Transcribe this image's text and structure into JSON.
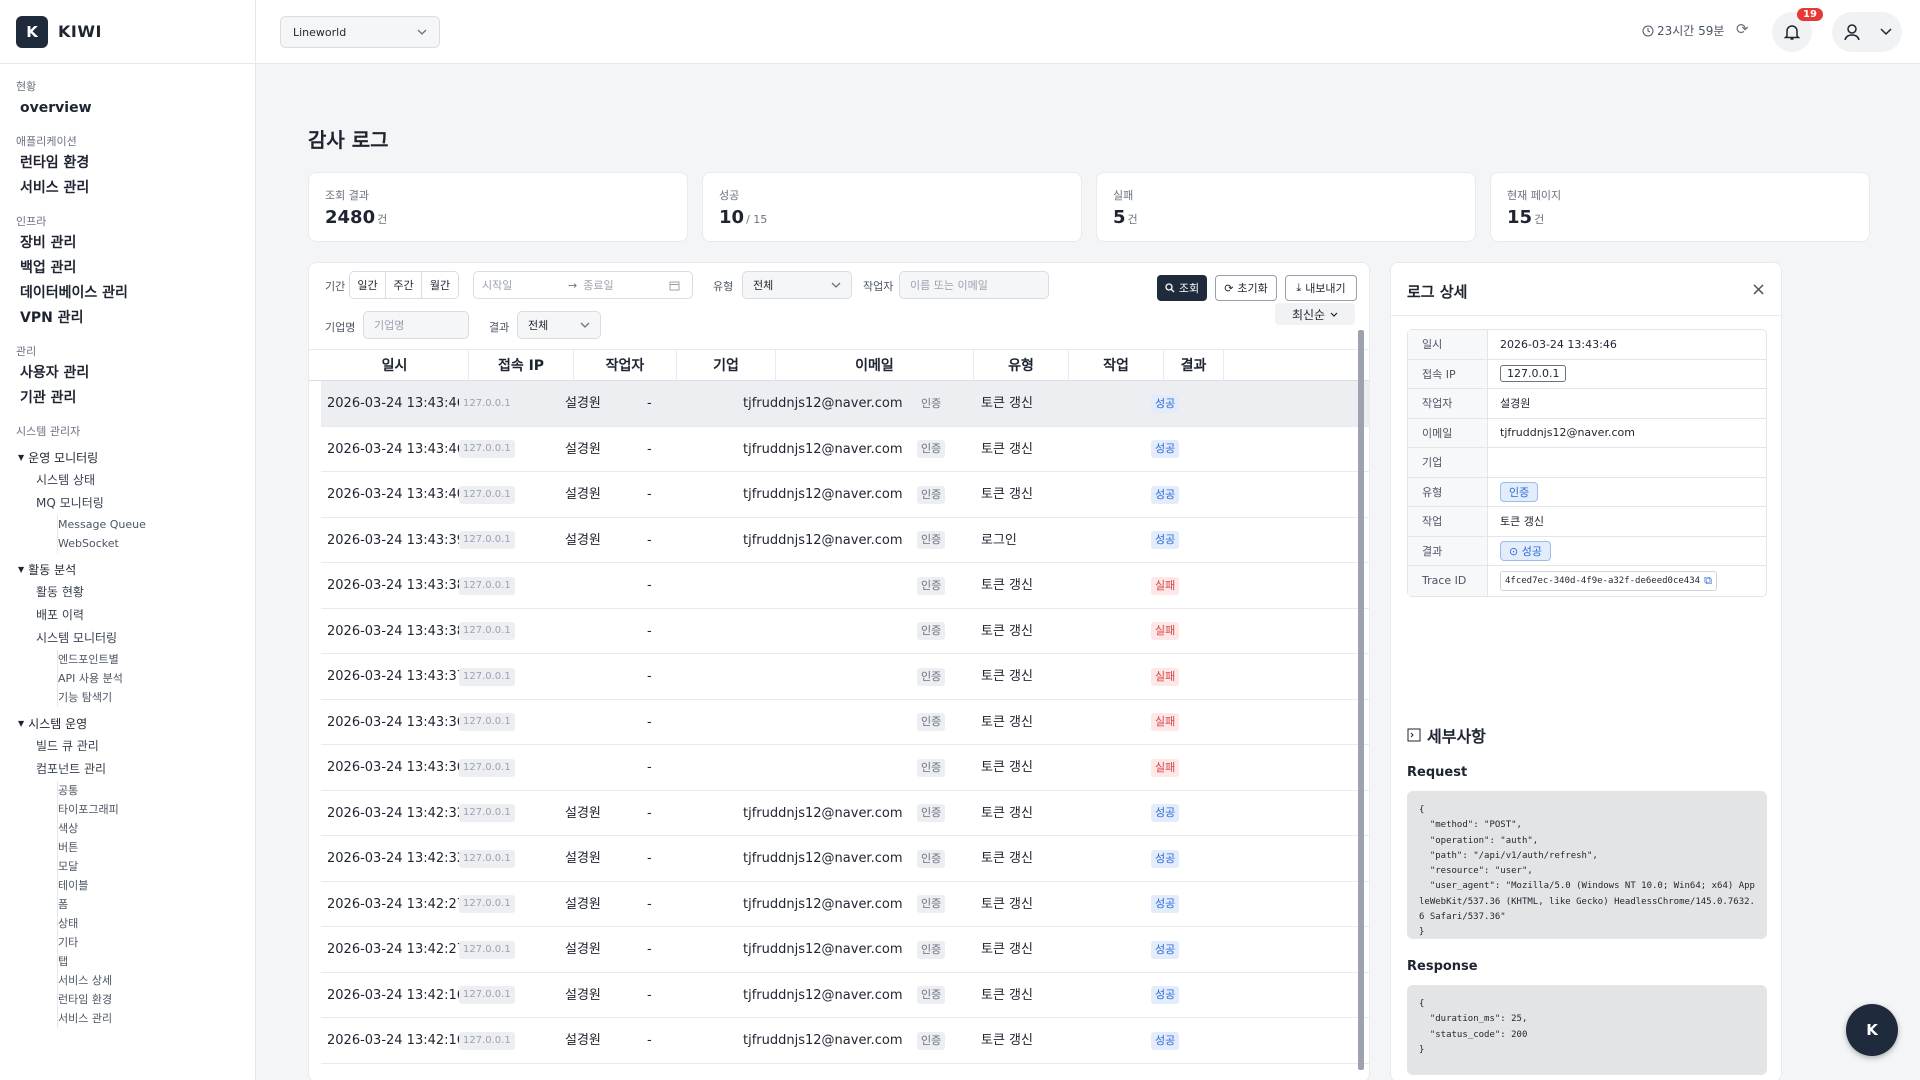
{
  "app": {
    "logo_letter": "K",
    "name": "KIWI"
  },
  "sidebar": {
    "sections": [
      {
        "title": "현황",
        "items": [
          "overview"
        ]
      },
      {
        "title": "애플리케이션",
        "items": [
          "런타임 환경",
          "서비스 관리"
        ]
      },
      {
        "title": "인프라",
        "items": [
          "장비 관리",
          "백업 관리",
          "데이터베이스 관리",
          "VPN 관리"
        ]
      },
      {
        "title": "관리",
        "items": [
          "사용자 관리",
          "기관 관리"
        ]
      }
    ],
    "sysadmin_title": "시스템 관리자",
    "groups": [
      {
        "label": "운영 모니터링",
        "items": [
          {
            "label": "시스템 상태"
          },
          {
            "label": "MQ 모니터링",
            "children": [
              "Message Queue",
              "WebSocket"
            ]
          }
        ]
      },
      {
        "label": "활동 분석",
        "items": [
          {
            "label": "활동 현황"
          },
          {
            "label": "배포 이력"
          },
          {
            "label": "시스템 모니터링",
            "children": [
              "엔드포인트별",
              "API 사용 분석",
              "기능 탐색기"
            ]
          }
        ]
      },
      {
        "label": "시스템 운영",
        "items": [
          {
            "label": "빌드 큐 관리"
          },
          {
            "label": "컴포넌트 관리",
            "children": [
              "공통",
              "타이포그래피",
              "색상",
              "버튼",
              "모달",
              "테이블",
              "폼",
              "상태",
              "기타",
              "탭",
              "서비스 상세",
              "런타임 환경",
              "서비스 관리"
            ]
          }
        ]
      }
    ]
  },
  "topbar": {
    "workspace": "Lineworld",
    "timer": "23시간 59분",
    "notif_count": "19"
  },
  "page": {
    "title": "감사 로그"
  },
  "cards": [
    {
      "label": "조회 결과",
      "value": "2480",
      "unit": "건"
    },
    {
      "label": "성공",
      "value": "10",
      "unit": "/ 15"
    },
    {
      "label": "실패",
      "value": "5",
      "unit": "건"
    },
    {
      "label": "현재 페이지",
      "value": "15",
      "unit": "건"
    }
  ],
  "filters": {
    "period_label": "기간",
    "period_options": [
      "일간",
      "주간",
      "월간"
    ],
    "start_placeholder": "시작일",
    "end_placeholder": "종료일",
    "type_label": "유형",
    "type_value": "전체",
    "actor_label": "작업자",
    "actor_placeholder": "이름 또는 이메일",
    "company_label": "기업명",
    "company_placeholder": "기업명",
    "result_label": "결과",
    "result_value": "전체",
    "search_btn": "조회",
    "reset_btn": "초기화",
    "export_btn": "내보내기",
    "sort": "최신순"
  },
  "table": {
    "columns": [
      "일시",
      "접속 IP",
      "작업자",
      "기업",
      "이메일",
      "유형",
      "작업",
      "결과"
    ],
    "rows": [
      {
        "time": "2026-03-24 13:43:46",
        "ip": "127.0.0.1",
        "actor": "설경원",
        "company": "-",
        "email": "tjfruddnjs12@naver.com",
        "type": "인증",
        "action": "토큰 갱신",
        "result": "성공",
        "ok": true
      },
      {
        "time": "2026-03-24 13:43:46",
        "ip": "127.0.0.1",
        "actor": "설경원",
        "company": "-",
        "email": "tjfruddnjs12@naver.com",
        "type": "인증",
        "action": "토큰 갱신",
        "result": "성공",
        "ok": true
      },
      {
        "time": "2026-03-24 13:43:40",
        "ip": "127.0.0.1",
        "actor": "설경원",
        "company": "-",
        "email": "tjfruddnjs12@naver.com",
        "type": "인증",
        "action": "토큰 갱신",
        "result": "성공",
        "ok": true
      },
      {
        "time": "2026-03-24 13:43:39",
        "ip": "127.0.0.1",
        "actor": "설경원",
        "company": "-",
        "email": "tjfruddnjs12@naver.com",
        "type": "인증",
        "action": "로그인",
        "result": "성공",
        "ok": true
      },
      {
        "time": "2026-03-24 13:43:38",
        "ip": "127.0.0.1",
        "actor": "",
        "company": "-",
        "email": "",
        "type": "인증",
        "action": "토큰 갱신",
        "result": "실패",
        "ok": false
      },
      {
        "time": "2026-03-24 13:43:38",
        "ip": "127.0.0.1",
        "actor": "",
        "company": "-",
        "email": "",
        "type": "인증",
        "action": "토큰 갱신",
        "result": "실패",
        "ok": false
      },
      {
        "time": "2026-03-24 13:43:37",
        "ip": "127.0.0.1",
        "actor": "",
        "company": "-",
        "email": "",
        "type": "인증",
        "action": "토큰 갱신",
        "result": "실패",
        "ok": false
      },
      {
        "time": "2026-03-24 13:43:36",
        "ip": "127.0.0.1",
        "actor": "",
        "company": "-",
        "email": "",
        "type": "인증",
        "action": "토큰 갱신",
        "result": "실패",
        "ok": false
      },
      {
        "time": "2026-03-24 13:43:36",
        "ip": "127.0.0.1",
        "actor": "",
        "company": "-",
        "email": "",
        "type": "인증",
        "action": "토큰 갱신",
        "result": "실패",
        "ok": false
      },
      {
        "time": "2026-03-24 13:42:32",
        "ip": "127.0.0.1",
        "actor": "설경원",
        "company": "-",
        "email": "tjfruddnjs12@naver.com",
        "type": "인증",
        "action": "토큰 갱신",
        "result": "성공",
        "ok": true
      },
      {
        "time": "2026-03-24 13:42:32",
        "ip": "127.0.0.1",
        "actor": "설경원",
        "company": "-",
        "email": "tjfruddnjs12@naver.com",
        "type": "인증",
        "action": "토큰 갱신",
        "result": "성공",
        "ok": true
      },
      {
        "time": "2026-03-24 13:42:27",
        "ip": "127.0.0.1",
        "actor": "설경원",
        "company": "-",
        "email": "tjfruddnjs12@naver.com",
        "type": "인증",
        "action": "토큰 갱신",
        "result": "성공",
        "ok": true
      },
      {
        "time": "2026-03-24 13:42:27",
        "ip": "127.0.0.1",
        "actor": "설경원",
        "company": "-",
        "email": "tjfruddnjs12@naver.com",
        "type": "인증",
        "action": "토큰 갱신",
        "result": "성공",
        "ok": true
      },
      {
        "time": "2026-03-24 13:42:16",
        "ip": "127.0.0.1",
        "actor": "설경원",
        "company": "-",
        "email": "tjfruddnjs12@naver.com",
        "type": "인증",
        "action": "토큰 갱신",
        "result": "성공",
        "ok": true
      },
      {
        "time": "2026-03-24 13:42:16",
        "ip": "127.0.0.1",
        "actor": "설경원",
        "company": "-",
        "email": "tjfruddnjs12@naver.com",
        "type": "인증",
        "action": "토큰 갱신",
        "result": "성공",
        "ok": true
      }
    ]
  },
  "detail": {
    "title": "로그 상세",
    "fields": [
      {
        "key": "일시",
        "value": "2026-03-24 13:43:46",
        "style": "plain"
      },
      {
        "key": "접속 IP",
        "value": "127.0.0.1",
        "style": "box"
      },
      {
        "key": "작업자",
        "value": "설경원",
        "style": "plain"
      },
      {
        "key": "이메일",
        "value": "tjfruddnjs12@naver.com",
        "style": "plain"
      },
      {
        "key": "기업",
        "value": "",
        "style": "plain"
      },
      {
        "key": "유형",
        "value": "인증",
        "style": "pill"
      },
      {
        "key": "작업",
        "value": "토큰 갱신",
        "style": "plain"
      },
      {
        "key": "결과",
        "value": "성공",
        "style": "result"
      },
      {
        "key": "Trace ID",
        "value": "4fced7ec-340d-4f9e-a32f-de6eed0ce434",
        "style": "trace"
      }
    ],
    "section_title": "세부사항",
    "request_label": "Request",
    "request_body": "{\n  \"method\": \"POST\",\n  \"operation\": \"auth\",\n  \"path\": \"/api/v1/auth/refresh\",\n  \"resource\": \"user\",\n  \"user_agent\": \"Mozilla/5.0 (Windows NT 10.0; Win64; x64) AppleWebKit/537.36 (KHTML, like Gecko) HeadlessChrome/145.0.7632.6 Safari/537.36\"\n}",
    "response_label": "Response",
    "response_body": "{\n  \"duration_ms\": 25,\n  \"status_code\": 200\n}"
  },
  "fab_letter": "K"
}
